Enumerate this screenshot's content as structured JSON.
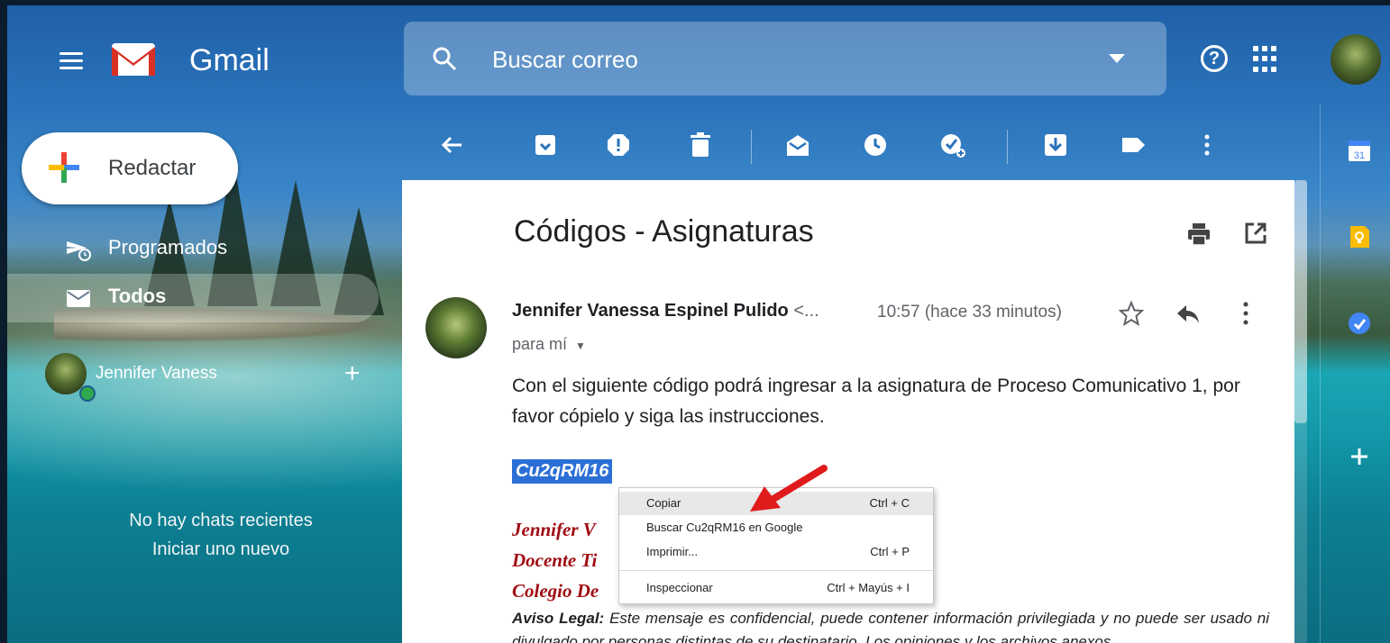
{
  "header": {
    "brand": "Gmail",
    "search_placeholder": "Buscar correo"
  },
  "sidebar": {
    "compose_label": "Redactar",
    "items": [
      {
        "label": "Programados"
      },
      {
        "label": "Todos"
      }
    ],
    "chat": {
      "user_name": "Jennifer Vaness",
      "empty_line1": "No hay chats recientes",
      "empty_line2": "Iniciar uno nuevo"
    }
  },
  "email": {
    "subject": "Códigos - Asignaturas",
    "sender_name": "Jennifer Vanessa Espinel Pulido",
    "sender_email_truncated": "<...",
    "time": "10:57 (hace 33 minutos)",
    "recipient": "para mí",
    "body": "Con el siguiente código podrá ingresar a la asignatura de Proceso Comunicativo 1, por favor cópielo y siga las instrucciones.",
    "code": "Cu2qRM16",
    "signature": [
      "Jennifer V",
      "Docente Ti",
      "Colegio De"
    ],
    "legal_label": "Aviso Legal:",
    "legal_text": " Este mensaje es confidencial, puede contener información privilegiada y no puede ser usado ni divulgado por personas distintas de su destinatario. Los opiniones y los archivos anexos"
  },
  "context_menu": {
    "items": [
      {
        "label": "Copiar",
        "shortcut": "Ctrl + C"
      },
      {
        "label": "Buscar Cu2qRM16 en Google",
        "shortcut": ""
      },
      {
        "label": "Imprimir...",
        "shortcut": "Ctrl + P"
      },
      {
        "label": "Inspeccionar",
        "shortcut": "Ctrl + Mayús + I"
      }
    ]
  },
  "side_panel": {
    "calendar_day": "31"
  },
  "colors": {
    "selection": "#2b6fd6",
    "signature": "#a00d12",
    "annotation_arrow": "#e01b1b"
  }
}
